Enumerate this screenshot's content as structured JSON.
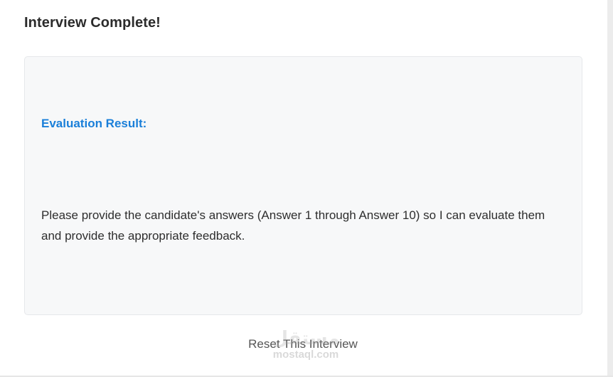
{
  "header": {
    "title": "Interview Complete!"
  },
  "evaluation": {
    "heading": "Evaluation Result:",
    "body": "Please provide the candidate's answers (Answer 1 through Answer 10) so I can evaluate them and provide the appropriate feedback."
  },
  "actions": {
    "reset_label": "Reset This Interview"
  },
  "watermark": {
    "mark": "مستقل",
    "text": "mostaql.com"
  },
  "colors": {
    "heading_accent": "#1a7fd9",
    "card_background": "#f7f8f9"
  }
}
